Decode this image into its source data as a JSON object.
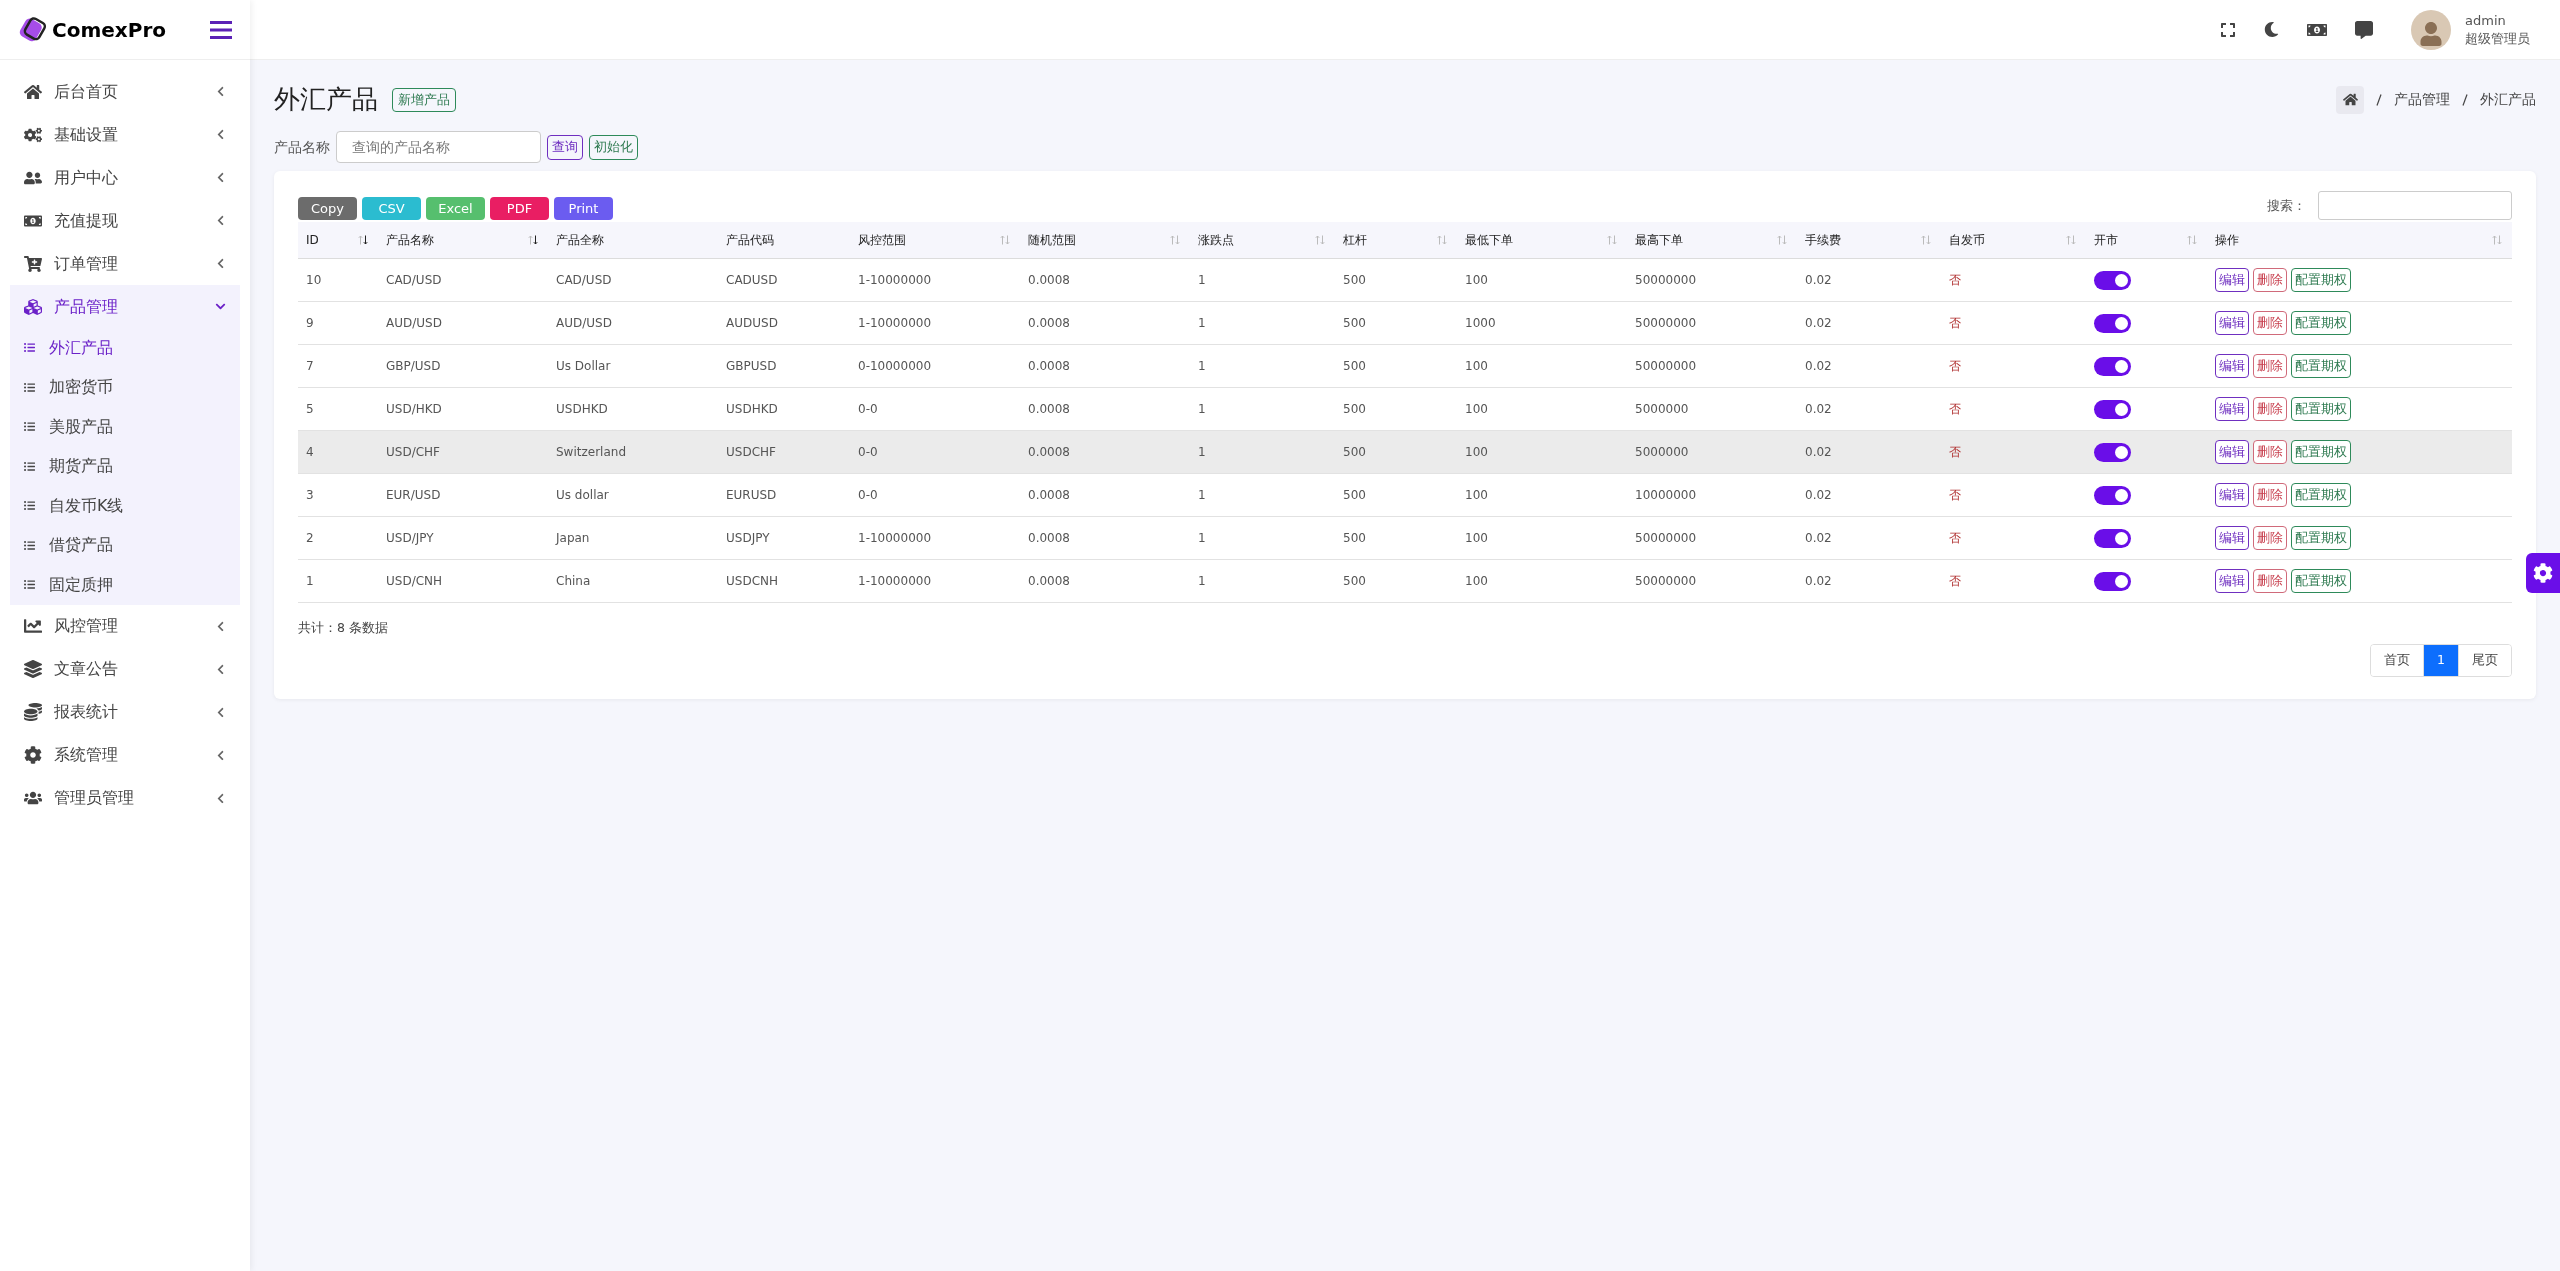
{
  "brand": "ComexPro",
  "sidebar": {
    "items": [
      {
        "label": "后台首页",
        "expanded": false,
        "selected": false
      },
      {
        "label": "基础设置",
        "expanded": false,
        "selected": false
      },
      {
        "label": "用户中心",
        "expanded": false,
        "selected": false
      },
      {
        "label": "充值提现",
        "expanded": false,
        "selected": false
      },
      {
        "label": "订单管理",
        "expanded": false,
        "selected": false
      },
      {
        "label": "产品管理",
        "expanded": true,
        "selected": true,
        "children": [
          {
            "label": "外汇产品",
            "selected": true
          },
          {
            "label": "加密货币",
            "selected": false
          },
          {
            "label": "美股产品",
            "selected": false
          },
          {
            "label": "期货产品",
            "selected": false
          },
          {
            "label": "自发币K线",
            "selected": false
          },
          {
            "label": "借贷产品",
            "selected": false
          },
          {
            "label": "固定质押",
            "selected": false
          }
        ]
      },
      {
        "label": "风控管理",
        "expanded": false,
        "selected": false
      },
      {
        "label": "文章公告",
        "expanded": false,
        "selected": false
      },
      {
        "label": "报表统计",
        "expanded": false,
        "selected": false
      },
      {
        "label": "系统管理",
        "expanded": false,
        "selected": false
      },
      {
        "label": "管理员管理",
        "expanded": false,
        "selected": false
      }
    ]
  },
  "user": {
    "name": "admin",
    "role": "超级管理员"
  },
  "page": {
    "title": "外汇产品",
    "add_button": "新增产品",
    "breadcrumb": [
      "产品管理",
      "外汇产品"
    ]
  },
  "filter": {
    "label": "产品名称",
    "placeholder": "查询的产品名称",
    "buttons": [
      "查询",
      "初始化"
    ]
  },
  "export_buttons": [
    "Copy",
    "CSV",
    "Excel",
    "PDF",
    "Print"
  ],
  "search_label": "搜索：",
  "table": {
    "columns": [
      {
        "label": "ID",
        "sortable": true,
        "sorted": true
      },
      {
        "label": "产品名称",
        "sortable": true,
        "sorted": true
      },
      {
        "label": "产品全称",
        "sortable": false
      },
      {
        "label": "产品代码",
        "sortable": false
      },
      {
        "label": "风控范围",
        "sortable": true,
        "sorted": false
      },
      {
        "label": "随机范围",
        "sortable": true,
        "sorted": false
      },
      {
        "label": "涨跌点",
        "sortable": true,
        "sorted": false
      },
      {
        "label": "杠杆",
        "sortable": true,
        "sorted": false
      },
      {
        "label": "最低下单",
        "sortable": true,
        "sorted": false
      },
      {
        "label": "最高下单",
        "sortable": true,
        "sorted": false
      },
      {
        "label": "手续费",
        "sortable": true,
        "sorted": false
      },
      {
        "label": "自发币",
        "sortable": true,
        "sorted": false
      },
      {
        "label": "开市",
        "sortable": true,
        "sorted": false
      },
      {
        "label": "操作",
        "sortable": true,
        "sorted": false
      }
    ],
    "rows": [
      {
        "cells": [
          "10",
          "CAD/USD",
          "CAD/USD",
          "CADUSD",
          "1-10000000",
          "0.0008",
          "1",
          "500",
          "100",
          "50000000",
          "0.02",
          "否"
        ],
        "open": true,
        "highlighted": false,
        "actions": [
          "编辑",
          "删除",
          "配置期权"
        ]
      },
      {
        "cells": [
          "9",
          "AUD/USD",
          "AUD/USD",
          "AUDUSD",
          "1-10000000",
          "0.0008",
          "1",
          "500",
          "1000",
          "50000000",
          "0.02",
          "否"
        ],
        "open": true,
        "highlighted": false,
        "actions": [
          "编辑",
          "删除",
          "配置期权"
        ]
      },
      {
        "cells": [
          "7",
          "GBP/USD",
          "Us Dollar",
          "GBPUSD",
          "0-10000000",
          "0.0008",
          "1",
          "500",
          "100",
          "50000000",
          "0.02",
          "否"
        ],
        "open": true,
        "highlighted": false,
        "actions": [
          "编辑",
          "删除",
          "配置期权"
        ]
      },
      {
        "cells": [
          "5",
          "USD/HKD",
          "USDHKD",
          "USDHKD",
          "0-0",
          "0.0008",
          "1",
          "500",
          "100",
          "5000000",
          "0.02",
          "否"
        ],
        "open": true,
        "highlighted": false,
        "actions": [
          "编辑",
          "删除",
          "配置期权"
        ]
      },
      {
        "cells": [
          "4",
          "USD/CHF",
          "Switzerland",
          "USDCHF",
          "0-0",
          "0.0008",
          "1",
          "500",
          "100",
          "5000000",
          "0.02",
          "否"
        ],
        "open": true,
        "highlighted": true,
        "actions": [
          "编辑",
          "删除",
          "配置期权"
        ]
      },
      {
        "cells": [
          "3",
          "EUR/USD",
          "Us dollar",
          "EURUSD",
          "0-0",
          "0.0008",
          "1",
          "500",
          "100",
          "10000000",
          "0.02",
          "否"
        ],
        "open": true,
        "highlighted": false,
        "actions": [
          "编辑",
          "删除",
          "配置期权"
        ]
      },
      {
        "cells": [
          "2",
          "USD/JPY",
          "Japan",
          "USDJPY",
          "1-10000000",
          "0.0008",
          "1",
          "500",
          "100",
          "50000000",
          "0.02",
          "否"
        ],
        "open": true,
        "highlighted": false,
        "actions": [
          "编辑",
          "删除",
          "配置期权"
        ]
      },
      {
        "cells": [
          "1",
          "USD/CNH",
          "China",
          "USDCNH",
          "1-10000000",
          "0.0008",
          "1",
          "500",
          "100",
          "50000000",
          "0.02",
          "否"
        ],
        "open": true,
        "highlighted": false,
        "actions": [
          "编辑",
          "删除",
          "配置期权"
        ]
      }
    ]
  },
  "total": "共计：8 条数据",
  "pagination": [
    {
      "label": "首页",
      "selected": false
    },
    {
      "label": "1",
      "selected": true
    },
    {
      "label": "尾页",
      "selected": false
    }
  ]
}
